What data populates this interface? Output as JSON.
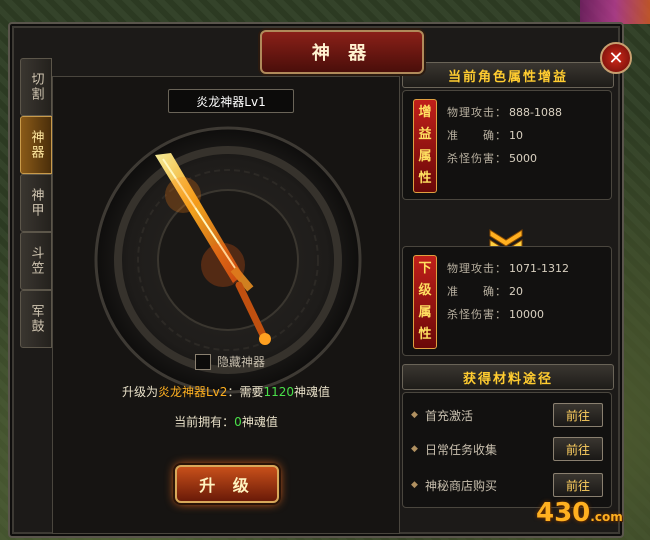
{
  "window": {
    "title": "神 器",
    "close_icon": "close-icon"
  },
  "tabs": [
    {
      "label": "切割",
      "active": false
    },
    {
      "label": "神器",
      "active": true
    },
    {
      "label": "神甲",
      "active": false
    },
    {
      "label": "斗笠",
      "active": false
    },
    {
      "label": "军鼓",
      "active": false
    }
  ],
  "artifact": {
    "name": "炎龙神器Lv1",
    "hide_label": "隐藏神器",
    "upgrade_prefix": "升级为",
    "next_name": "炎龙神器Lv2",
    "upgrade_mid": "：需要",
    "required": "1120",
    "upgrade_suffix": "神魂值",
    "own_prefix": "当前拥有：",
    "own_value": "0",
    "own_suffix": "神魂值",
    "upgrade_button": "升 级"
  },
  "current": {
    "header": "当前角色属性增益",
    "badge": [
      "增",
      "益",
      "属",
      "性"
    ],
    "stats": [
      {
        "k": "物理攻击：",
        "v": "888-1088"
      },
      {
        "k": "准　　确：",
        "v": "10"
      },
      {
        "k": "杀怪伤害：",
        "v": "5000"
      }
    ]
  },
  "next": {
    "badge": [
      "下",
      "级",
      "属",
      "性"
    ],
    "stats": [
      {
        "k": "物理攻击：",
        "v": "1071-1312"
      },
      {
        "k": "准　　确：",
        "v": "20"
      },
      {
        "k": "杀怪伤害：",
        "v": "10000"
      }
    ]
  },
  "sources": {
    "header": "获得材料途径",
    "items": [
      {
        "label": "首充激活",
        "button": "前往"
      },
      {
        "label": "日常任务收集",
        "button": "前往"
      },
      {
        "label": "神秘商店购买",
        "button": "前往"
      }
    ]
  },
  "logo": {
    "main": "430",
    "suffix": ".com"
  },
  "colors": {
    "accent": "#ffcc30",
    "highlight": "#ffb020",
    "green": "#4ae04a",
    "title_red": "#8a2018"
  }
}
